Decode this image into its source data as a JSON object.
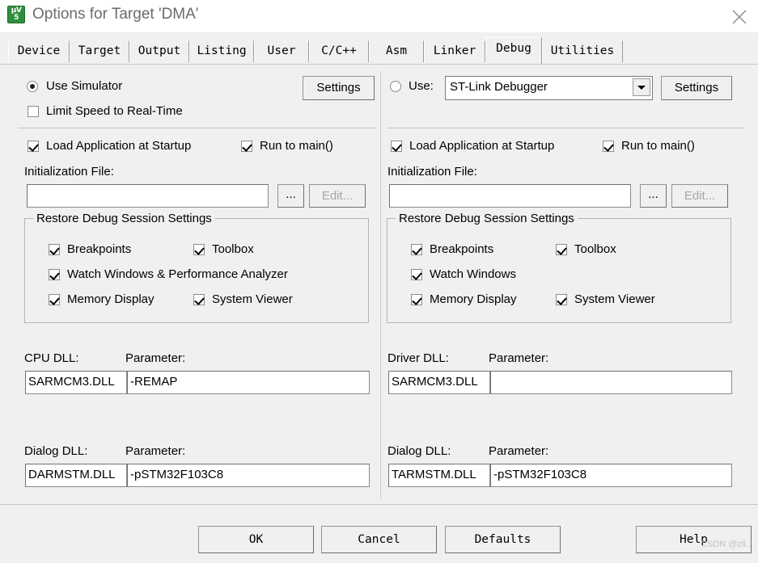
{
  "window": {
    "title": "Options for Target 'DMA'",
    "icon": "uvision-icon",
    "icon_line1": "μV",
    "icon_line2": "5",
    "close_label": "×"
  },
  "tabs": [
    {
      "label": "Device",
      "selected": false
    },
    {
      "label": "Target",
      "selected": false
    },
    {
      "label": "Output",
      "selected": false
    },
    {
      "label": "Listing",
      "selected": false
    },
    {
      "label": "User",
      "selected": false
    },
    {
      "label": "C/C++",
      "selected": false
    },
    {
      "label": "Asm",
      "selected": false
    },
    {
      "label": "Linker",
      "selected": false
    },
    {
      "label": "Debug",
      "selected": true
    },
    {
      "label": "Utilities",
      "selected": false
    }
  ],
  "simulator": {
    "use_simulator_label": "Use Simulator",
    "use_simulator_checked": true,
    "limit_speed_label": "Limit Speed to Real-Time",
    "limit_speed_checked": false,
    "settings_label": "Settings",
    "load_app_label": "Load Application at Startup",
    "load_app_checked": true,
    "run_to_main_label": "Run to main()",
    "run_to_main_checked": true,
    "init_file_label": "Initialization File:",
    "init_file_value": "",
    "browse_label": "...",
    "edit_label": "Edit...",
    "edit_disabled": true,
    "restore_group_title": "Restore Debug Session Settings",
    "restore_items": [
      {
        "label": "Breakpoints",
        "checked": true
      },
      {
        "label": "Toolbox",
        "checked": true
      },
      {
        "label": "Watch Windows & Performance Analyzer",
        "checked": true
      },
      {
        "label": "Memory Display",
        "checked": true
      },
      {
        "label": "System Viewer",
        "checked": true
      }
    ],
    "cpu_dll_label": "CPU DLL:",
    "cpu_dll_value": "SARMCM3.DLL",
    "cpu_param_label": "Parameter:",
    "cpu_param_value": "-REMAP",
    "dialog_dll_label": "Dialog DLL:",
    "dialog_dll_value": "DARMSTM.DLL",
    "dialog_param_label": "Parameter:",
    "dialog_param_value": "-pSTM32F103C8"
  },
  "hardware": {
    "use_label": "Use:",
    "use_checked": false,
    "debugger_value": "ST-Link Debugger",
    "settings_label": "Settings",
    "load_app_label": "Load Application at Startup",
    "load_app_checked": true,
    "run_to_main_label": "Run to main()",
    "run_to_main_checked": true,
    "init_file_label": "Initialization File:",
    "init_file_value": "",
    "browse_label": "...",
    "edit_label": "Edit...",
    "edit_disabled": true,
    "restore_group_title": "Restore Debug Session Settings",
    "restore_items": [
      {
        "label": "Breakpoints",
        "checked": true
      },
      {
        "label": "Toolbox",
        "checked": true
      },
      {
        "label": "Watch Windows",
        "checked": true
      },
      {
        "label": "Memory Display",
        "checked": true
      },
      {
        "label": "System Viewer",
        "checked": true
      }
    ],
    "driver_dll_label": "Driver DLL:",
    "driver_dll_value": "SARMCM3.DLL",
    "driver_param_label": "Parameter:",
    "driver_param_value": "",
    "dialog_dll_label": "Dialog DLL:",
    "dialog_dll_value": "TARMSTM.DLL",
    "dialog_param_label": "Parameter:",
    "dialog_param_value": "-pSTM32F103C8"
  },
  "footer": {
    "ok_label": "OK",
    "cancel_label": "Cancel",
    "defaults_label": "Defaults",
    "help_label": "Help",
    "watermark": "CSDN @zll..."
  },
  "colors": {
    "dialog_bg": "#f0f0f0",
    "field_bg": "#ffffff",
    "icon_green": "#2f8f3f",
    "title_text": "#6b6b6b",
    "disabled_text": "#a6a6a6"
  }
}
